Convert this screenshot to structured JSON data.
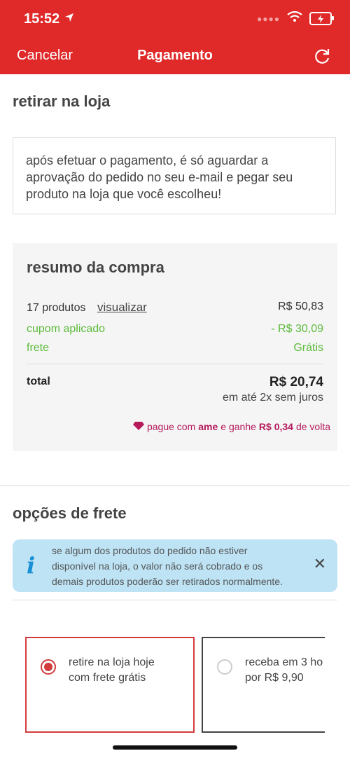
{
  "status": {
    "time": "15:52"
  },
  "nav": {
    "cancel": "Cancelar",
    "title": "Pagamento"
  },
  "pickup": {
    "title": "retirar na loja",
    "notice": "após efetuar o pagamento, é só aguardar a aprovação do pedido no seu e-mail e pegar seu produto na loja que você escolheu!"
  },
  "summary": {
    "title": "resumo da compra",
    "products_label": "17 produtos",
    "view_link": "visualizar",
    "products_value": "R$ 50,83",
    "coupon_label": "cupom aplicado",
    "coupon_value": "- R$ 30,09",
    "shipping_label": "frete",
    "shipping_value": "Grátis",
    "total_label": "total",
    "total_value": "R$ 20,74",
    "installments": "em até 2x sem juros",
    "ame_prefix": "pague com",
    "ame_brand": "ame",
    "ame_middle": "e ganhe",
    "ame_amount": "R$ 0,34",
    "ame_suffix": "de volta"
  },
  "shipping_options": {
    "title": "opções de frete",
    "info": "se algum dos produtos do pedido não estiver disponível na loja, o valor não será cobrado e os demais produtos poderão ser retirados normalmente.",
    "options": [
      {
        "line1": "retire na loja hoje",
        "line2": "com frete grátis",
        "selected": true
      },
      {
        "line1": "receba em 3 ho",
        "line2": "por R$ 9,90",
        "selected": false
      }
    ]
  },
  "colors": {
    "brand": "#e02a2a",
    "green": "#5dbb3b",
    "ame": "#b51a5b",
    "info_bg": "#bde3f5"
  }
}
